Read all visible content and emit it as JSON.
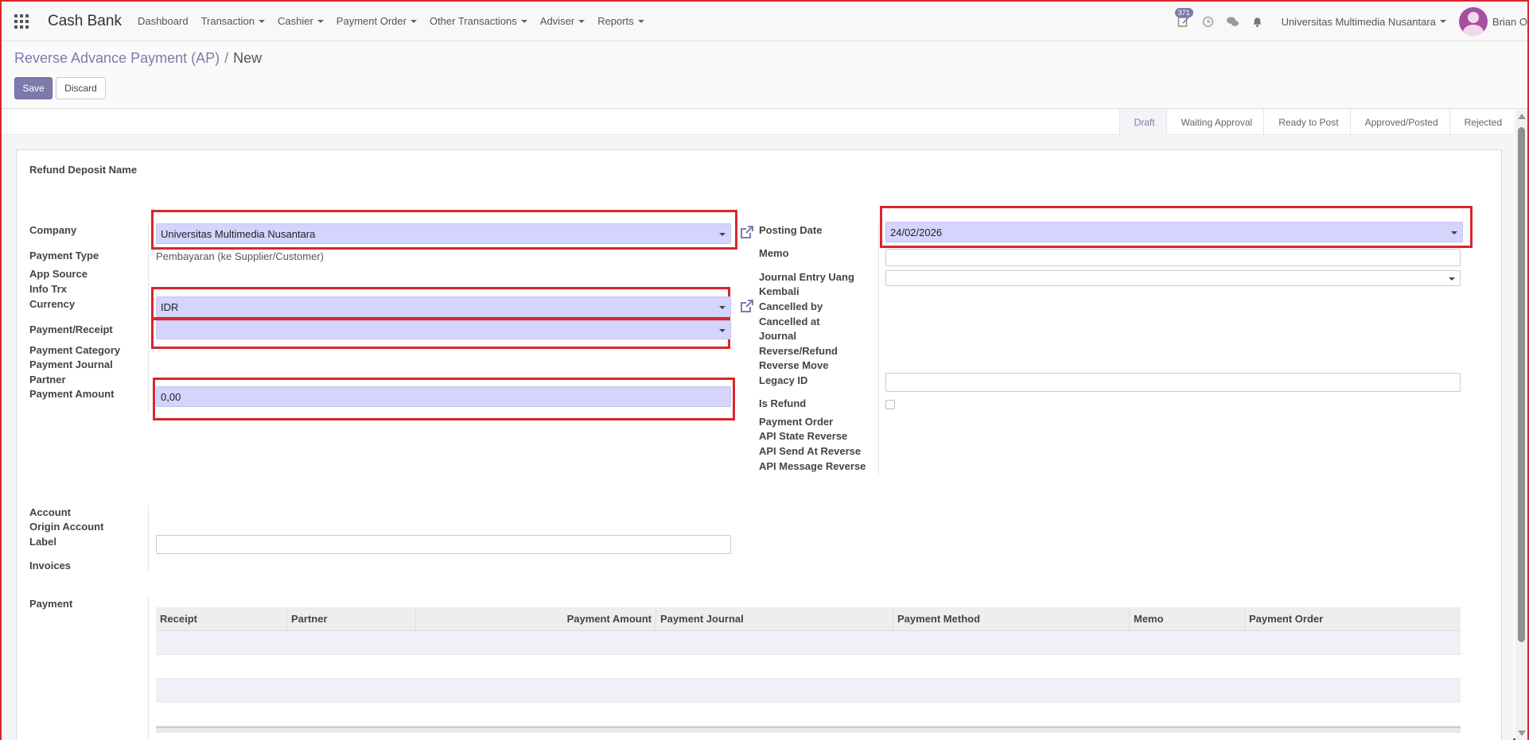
{
  "navbar": {
    "app_name": "Cash Bank",
    "menu": [
      {
        "label": "Dashboard",
        "dropdown": false
      },
      {
        "label": "Transaction",
        "dropdown": true
      },
      {
        "label": "Cashier",
        "dropdown": true
      },
      {
        "label": "Payment Order",
        "dropdown": true
      },
      {
        "label": "Other Transactions",
        "dropdown": true
      },
      {
        "label": "Adviser",
        "dropdown": true
      },
      {
        "label": "Reports",
        "dropdown": true
      }
    ],
    "activity_badge": "371",
    "company": "Universitas Multimedia Nusantara",
    "user": "Brian O"
  },
  "breadcrumb": {
    "parent": "Reverse Advance Payment (AP)",
    "separator": "/",
    "current": "New"
  },
  "buttons": {
    "save": "Save",
    "discard": "Discard"
  },
  "statusbar": [
    "Draft",
    "Waiting Approval",
    "Ready to Post",
    "Approved/Posted",
    "Rejected"
  ],
  "status_active": "Draft",
  "form": {
    "title_label": "Refund Deposit Name",
    "left": {
      "company_label": "Company",
      "company_value": "Universitas Multimedia Nusantara",
      "payment_type_label": "Payment Type",
      "payment_type_value": "Pembayaran (ke Supplier/Customer)",
      "app_source_label": "App Source",
      "info_trx_label": "Info Trx",
      "currency_label": "Currency",
      "currency_value": "IDR",
      "payment_receipt_label": "Payment/Receipt",
      "payment_receipt_value": "",
      "payment_category_label": "Payment Category",
      "payment_journal_label": "Payment Journal",
      "partner_label": "Partner",
      "payment_amount_label": "Payment Amount",
      "payment_amount_value": "0,00"
    },
    "right": {
      "posting_date_label": "Posting Date",
      "posting_date_value": "24/02/2026",
      "memo_label": "Memo",
      "journal_entry_label_1": "Journal Entry Uang",
      "journal_entry_label_2": "Kembali",
      "cancelled_by_label": "Cancelled by",
      "cancelled_at_label": "Cancelled at",
      "journal_reverse_label_1": "Journal",
      "journal_reverse_label_2": "Reverse/Refund",
      "reverse_move_label": "Reverse Move",
      "legacy_id_label": "Legacy ID",
      "is_refund_label": "Is Refund",
      "payment_order_label": "Payment Order",
      "api_state_label": "API State Reverse",
      "api_send_label": "API Send At Reverse",
      "api_message_label": "API Message Reverse"
    },
    "lower": {
      "account_label": "Account",
      "origin_account_label": "Origin Account",
      "label_label": "Label",
      "invoices_label": "Invoices",
      "payment_label": "Payment"
    }
  },
  "payment_table": {
    "columns": [
      "Receipt",
      "Partner",
      "Payment Amount",
      "Payment Journal",
      "Payment Method",
      "Memo",
      "Payment Order"
    ]
  }
}
